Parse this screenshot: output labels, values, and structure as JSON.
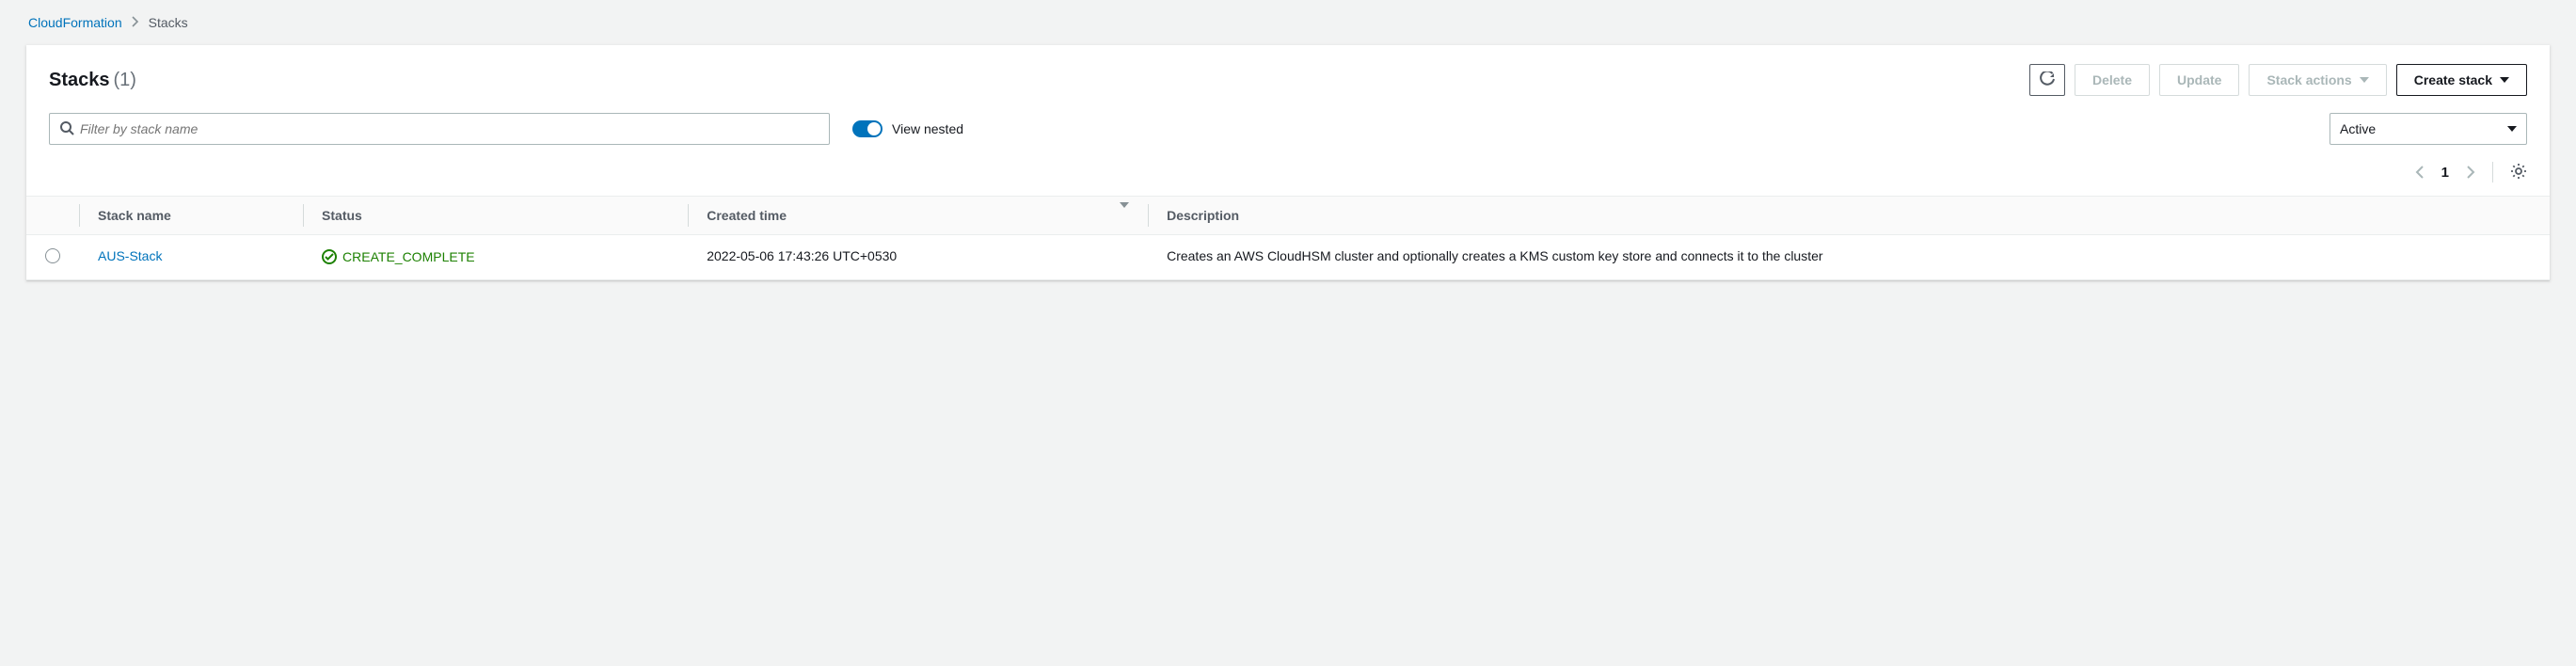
{
  "breadcrumb": {
    "root": "CloudFormation",
    "current": "Stacks"
  },
  "header": {
    "title": "Stacks",
    "count": "(1)",
    "buttons": {
      "delete": "Delete",
      "update": "Update",
      "stack_actions": "Stack actions",
      "create_stack": "Create stack"
    }
  },
  "filters": {
    "search_placeholder": "Filter by stack name",
    "view_nested_label": "View nested",
    "status_selected": "Active"
  },
  "pagination": {
    "current": "1"
  },
  "table": {
    "columns": {
      "stack_name": "Stack name",
      "status": "Status",
      "created_time": "Created time",
      "description": "Description"
    },
    "rows": [
      {
        "name": "AUS-Stack",
        "status": "CREATE_COMPLETE",
        "created": "2022-05-06 17:43:26 UTC+0530",
        "description": "Creates an AWS CloudHSM cluster and optionally creates a KMS custom key store and connects it to the cluster"
      }
    ]
  }
}
